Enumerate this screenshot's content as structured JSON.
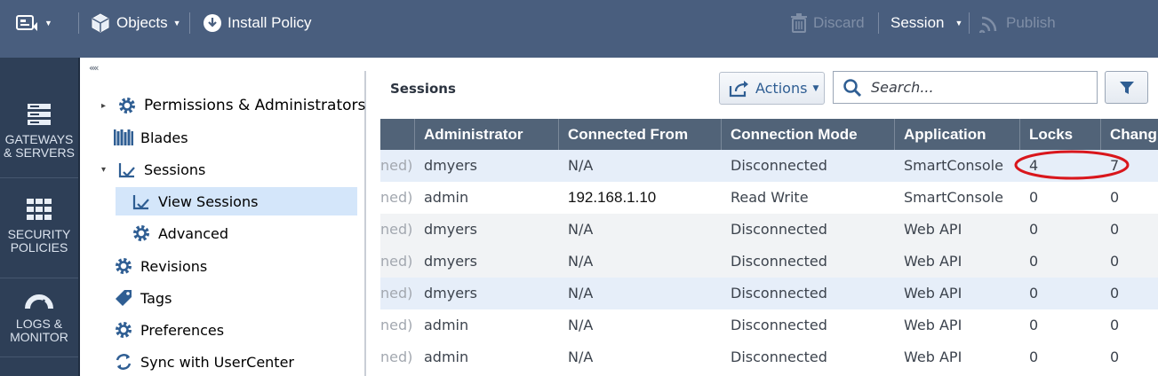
{
  "toolbar": {
    "objects_label": "Objects",
    "install_policy_label": "Install Policy",
    "discard_label": "Discard",
    "session_label": "Session",
    "publish_label": "Publish"
  },
  "left_nav": {
    "items": [
      {
        "line1": "GATEWAYS",
        "line2": "& SERVERS",
        "icon": "gateways-servers-icon"
      },
      {
        "line1": "SECURITY",
        "line2": "POLICIES",
        "icon": "security-policies-icon"
      },
      {
        "line1": "LOGS &",
        "line2": "MONITOR",
        "icon": "logs-monitor-icon"
      }
    ]
  },
  "tree": {
    "collapse_glyph": "««",
    "items": [
      {
        "label": "Permissions & Administrators"
      },
      {
        "label": "Blades"
      },
      {
        "label": "Sessions"
      },
      {
        "label": "View Sessions"
      },
      {
        "label": "Advanced"
      },
      {
        "label": "Revisions"
      },
      {
        "label": "Tags"
      },
      {
        "label": "Preferences"
      },
      {
        "label": "Sync with UserCenter"
      }
    ]
  },
  "sessions_panel": {
    "title": "Sessions",
    "actions_label": "Actions",
    "search_placeholder": "Search...",
    "columns": [
      "Administrator",
      "Connected From",
      "Connection Mode",
      "Application",
      "Locks",
      "Chang"
    ],
    "rows": [
      {
        "prefix": "ned)",
        "admin": "dmyers",
        "from": "N/A",
        "mode": "Disconnected",
        "app": "SmartConsole",
        "locks": "4",
        "changes": "7"
      },
      {
        "prefix": "ned)",
        "admin": "admin",
        "from": "192.168.1.10",
        "mode": "Read Write",
        "app": "SmartConsole",
        "locks": "0",
        "changes": "0"
      },
      {
        "prefix": "ned)",
        "admin": "dmyers",
        "from": "N/A",
        "mode": "Disconnected",
        "app": "Web API",
        "locks": "0",
        "changes": "0"
      },
      {
        "prefix": "ned)",
        "admin": "dmyers",
        "from": "N/A",
        "mode": "Disconnected",
        "app": "Web API",
        "locks": "0",
        "changes": "0"
      },
      {
        "prefix": "ned)",
        "admin": "dmyers",
        "from": "N/A",
        "mode": "Disconnected",
        "app": "Web API",
        "locks": "0",
        "changes": "0"
      },
      {
        "prefix": "ned)",
        "admin": "admin",
        "from": "N/A",
        "mode": "Disconnected",
        "app": "Web API",
        "locks": "0",
        "changes": "0"
      },
      {
        "prefix": "ned)",
        "admin": "admin",
        "from": "N/A",
        "mode": "Disconnected",
        "app": "Web API",
        "locks": "0",
        "changes": "0"
      }
    ]
  },
  "colors": {
    "topbar": "#495e7e",
    "nav": "#2e3f57",
    "grid_header": "#516378",
    "selected_row": "#e6eef9",
    "annotation": "#d9161c"
  }
}
